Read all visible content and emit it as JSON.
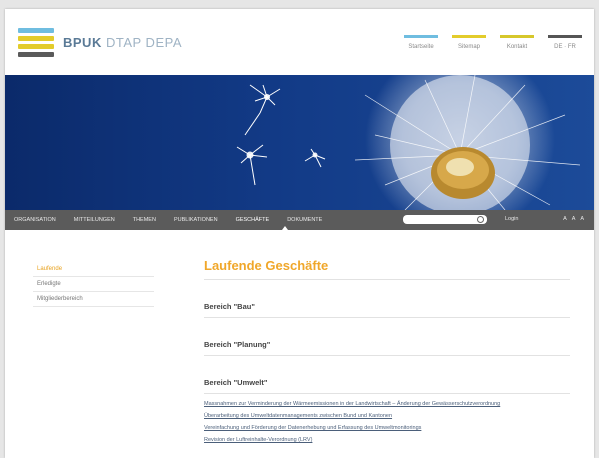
{
  "header": {
    "brand_primary": "BPUK",
    "brand_secondary": "DTAP DEPA",
    "logo_colors": [
      "#6fbde0",
      "#e3cc2b",
      "#e3cc2b",
      "#5a5a5a"
    ],
    "topnav": [
      {
        "label": "Startseite",
        "color": "#6fbde0"
      },
      {
        "label": "Sitemap",
        "color": "#e3cc2b"
      },
      {
        "label": "Kontakt",
        "color": "#d6c72b"
      },
      {
        "label": "DE · FR",
        "color": "#555555"
      }
    ]
  },
  "mainnav": {
    "items": [
      "Organisation",
      "Mitteilungen",
      "Themen",
      "Publikationen",
      "Geschäfte",
      "Dokumente"
    ],
    "active_index": 4,
    "search_placeholder": "",
    "login_label": "Login",
    "size_label": "A A A"
  },
  "sidebar": {
    "items": [
      "Laufende",
      "Erledigte",
      "Mitgliederbereich"
    ]
  },
  "main": {
    "title": "Laufende Geschäfte",
    "sections": [
      {
        "title": "Bereich \"Bau\"",
        "links": []
      },
      {
        "title": "Bereich \"Planung\"",
        "links": []
      },
      {
        "title": "Bereich \"Umwelt\"",
        "links": [
          "Massnahmen zur Verminderung der Wärmeemissionen in der Landwirtschaft – Änderung der Gewässerschutzverordnung",
          "Überarbeitung des Umweltdatenmanagements zwischen Bund und Kantonen",
          "Vereinfachung und Förderung der Datenerhebung und Erfassung des Umweltmonitorings",
          "Revision der Luftreinhalte-Verordnung (LRV)"
        ]
      }
    ]
  }
}
